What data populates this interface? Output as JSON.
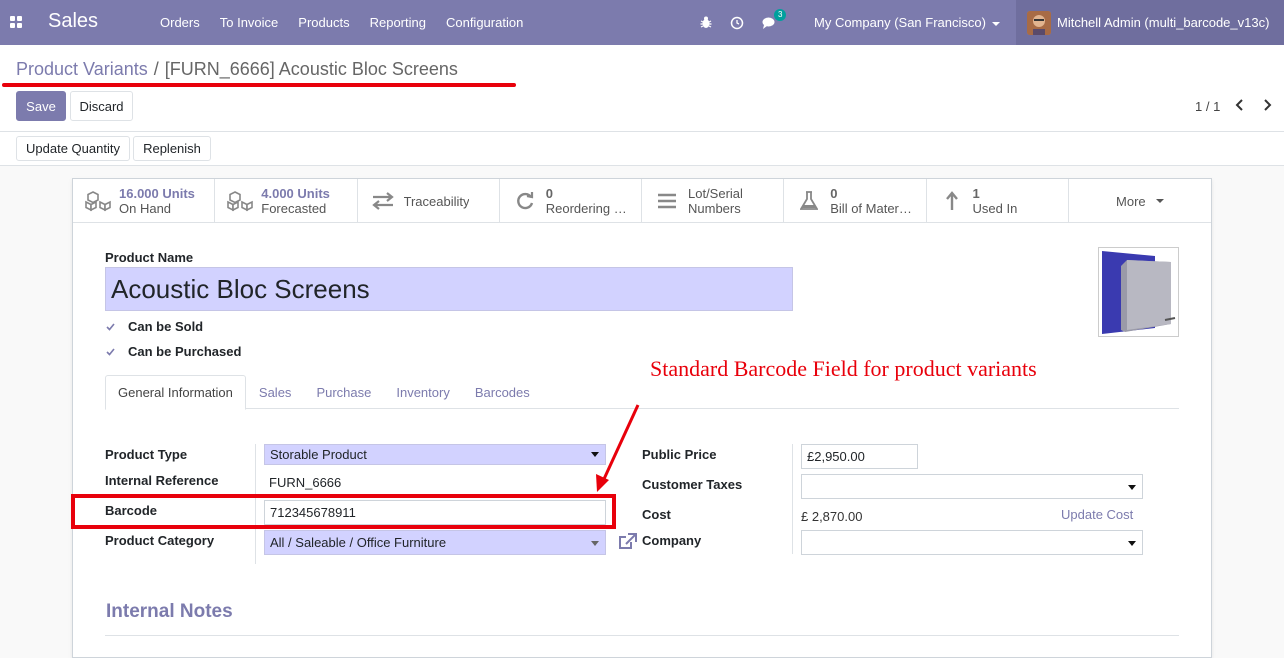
{
  "navbar": {
    "app_title": "Sales",
    "menu": [
      "Orders",
      "To Invoice",
      "Products",
      "Reporting",
      "Configuration"
    ],
    "messages_badge": "3",
    "company": "My Company (San Francisco)",
    "user": "Mitchell Admin (multi_barcode_v13c)",
    "bg_color": "#7c7bad"
  },
  "breadcrumb": {
    "parent": "Product Variants",
    "separator": "/",
    "current": "[FURN_6666] Acoustic Bloc Screens"
  },
  "buttons": {
    "save": "Save",
    "discard": "Discard",
    "update_quantity": "Update Quantity",
    "replenish": "Replenish"
  },
  "pager": {
    "value": "1 / 1"
  },
  "stats": [
    {
      "icon": "cubes-icon",
      "value": "16.000 Units",
      "label": "On Hand"
    },
    {
      "icon": "cubes-icon",
      "value": "4.000 Units",
      "label": "Forecasted"
    },
    {
      "icon": "arrows-exchange-icon",
      "value": "",
      "label": "Traceability"
    },
    {
      "icon": "refresh-icon",
      "value": "0",
      "label": "Reordering Rules"
    },
    {
      "icon": "list-icon",
      "value": "Lot/Serial",
      "label": "Numbers"
    },
    {
      "icon": "flask-icon",
      "value": "0",
      "label": "Bill of Materials"
    },
    {
      "icon": "level-up-icon",
      "value": "1",
      "label": "Used In"
    },
    {
      "icon": "",
      "value": "",
      "label": "More"
    }
  ],
  "form": {
    "product_name_label": "Product Name",
    "product_name": "Acoustic Bloc Screens",
    "can_be_sold": "Can be Sold",
    "can_be_purchased": "Can be Purchased",
    "tabs": [
      "General Information",
      "Sales",
      "Purchase",
      "Inventory",
      "Barcodes"
    ],
    "left": {
      "product_type_label": "Product Type",
      "product_type": "Storable Product",
      "internal_reference_label": "Internal Reference",
      "internal_reference": "FURN_6666",
      "barcode_label": "Barcode",
      "barcode": "712345678911",
      "product_category_label": "Product Category",
      "product_category": "All / Saleable / Office Furniture"
    },
    "right": {
      "public_price_label": "Public Price",
      "public_price": "£2,950.00",
      "customer_taxes_label": "Customer Taxes",
      "customer_taxes": "",
      "cost_label": "Cost",
      "cost": "£ 2,870.00",
      "update_cost": "Update Cost",
      "company_label": "Company",
      "company": ""
    },
    "internal_notes_title": "Internal Notes"
  },
  "annotation": {
    "text": "Standard Barcode Field for product variants",
    "color": "#e8000b"
  }
}
